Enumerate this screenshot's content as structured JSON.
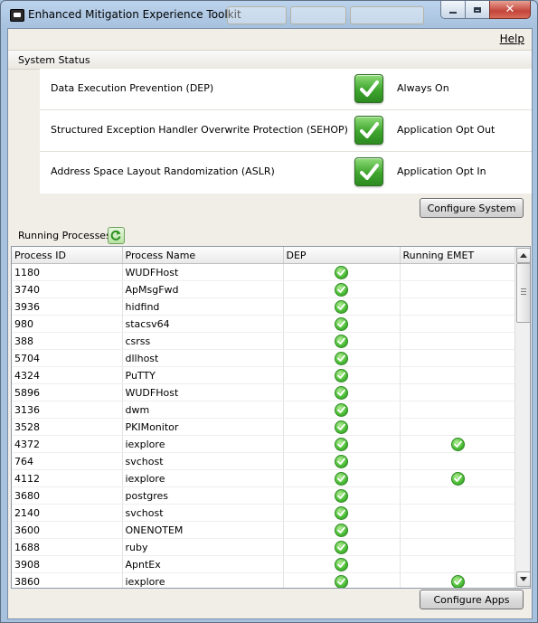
{
  "window": {
    "title": "Enhanced Mitigation Experience Toolkit"
  },
  "menu": {
    "help": "Help"
  },
  "system_status": {
    "header": "System Status",
    "items": [
      {
        "feature": "Data Execution Prevention (DEP)",
        "state": "Always On",
        "icon": "check-icon"
      },
      {
        "feature": "Structured Exception Handler Overwrite Protection (SEHOP)",
        "state": "Application Opt Out",
        "icon": "check-icon"
      },
      {
        "feature": "Address Space Layout Randomization (ASLR)",
        "state": "Application Opt In",
        "icon": "check-icon"
      }
    ],
    "configure_label": "Configure System"
  },
  "processes": {
    "header": "Running Processes",
    "columns": [
      "Process ID",
      "Process Name",
      "DEP",
      "Running EMET"
    ],
    "rows": [
      {
        "pid": "1180",
        "name": "WUDFHost",
        "dep": true,
        "emet": false
      },
      {
        "pid": "3740",
        "name": "ApMsgFwd",
        "dep": true,
        "emet": false
      },
      {
        "pid": "3936",
        "name": "hidfind",
        "dep": true,
        "emet": false
      },
      {
        "pid": "980",
        "name": "stacsv64",
        "dep": true,
        "emet": false
      },
      {
        "pid": "388",
        "name": "csrss",
        "dep": true,
        "emet": false
      },
      {
        "pid": "5704",
        "name": "dllhost",
        "dep": true,
        "emet": false
      },
      {
        "pid": "4324",
        "name": "PuTTY",
        "dep": true,
        "emet": false
      },
      {
        "pid": "5896",
        "name": "WUDFHost",
        "dep": true,
        "emet": false
      },
      {
        "pid": "3136",
        "name": "dwm",
        "dep": true,
        "emet": false
      },
      {
        "pid": "3528",
        "name": "PKIMonitor",
        "dep": true,
        "emet": false
      },
      {
        "pid": "4372",
        "name": "iexplore",
        "dep": true,
        "emet": true
      },
      {
        "pid": "764",
        "name": "svchost",
        "dep": true,
        "emet": false
      },
      {
        "pid": "4112",
        "name": "iexplore",
        "dep": true,
        "emet": true
      },
      {
        "pid": "3680",
        "name": "postgres",
        "dep": true,
        "emet": false
      },
      {
        "pid": "2140",
        "name": "svchost",
        "dep": true,
        "emet": false
      },
      {
        "pid": "3600",
        "name": "ONENOTEM",
        "dep": true,
        "emet": false
      },
      {
        "pid": "1688",
        "name": "ruby",
        "dep": true,
        "emet": false
      },
      {
        "pid": "3908",
        "name": "ApntEx",
        "dep": true,
        "emet": false
      },
      {
        "pid": "3860",
        "name": "iexplore",
        "dep": true,
        "emet": true
      }
    ],
    "configure_label": "Configure Apps"
  },
  "colors": {
    "check": "#3ea52e",
    "title_bar": "#a7c2df",
    "close": "#c4443a"
  }
}
